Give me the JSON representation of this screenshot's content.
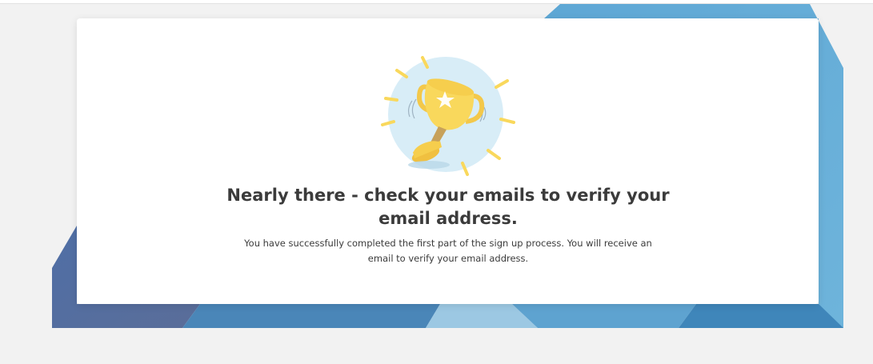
{
  "confirmation": {
    "heading": "Nearly there - check your emails to verify your email address.",
    "message": "You have successfully completed the first part of the sign up process. You will receive an email to verify your email address."
  },
  "illustration": {
    "icon": "trophy-icon"
  },
  "colors": {
    "page_background": "#f2f2f2",
    "card_background": "#ffffff",
    "heading_text": "#3b3b3b",
    "backdrop_light_blue": "#6aaed6",
    "backdrop_mid_blue": "#4a8fc0",
    "backdrop_dark_blue": "#4d6e9e",
    "trophy_gold": "#f9d85c",
    "trophy_circle": "#d8edf7"
  }
}
